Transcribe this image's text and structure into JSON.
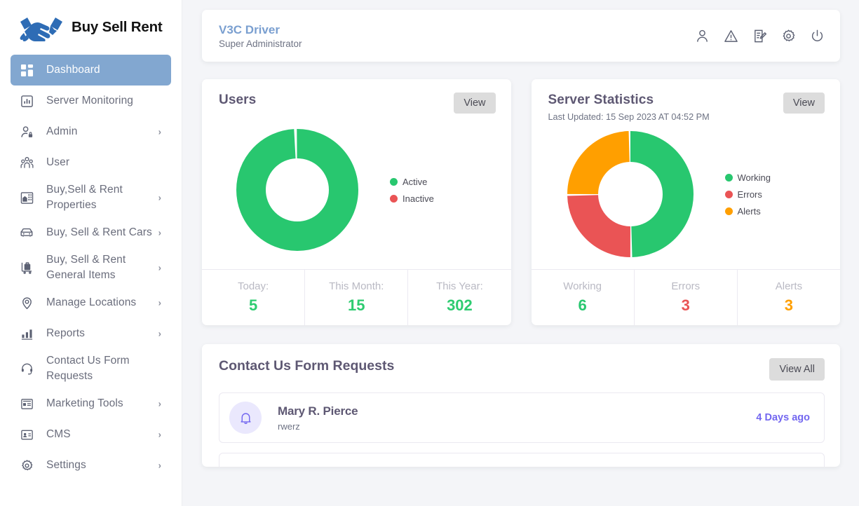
{
  "brand": {
    "name": "Buy Sell Rent",
    "logo_icon": "handshake-icon",
    "logo_color": "#2e6cb5"
  },
  "sidebar": {
    "items": [
      {
        "label": "Dashboard",
        "icon": "grid-dashboard-icon",
        "active": true,
        "chevron": ""
      },
      {
        "label": "Server Monitoring",
        "icon": "chart-bar-box-icon",
        "active": false,
        "chevron": ""
      },
      {
        "label": "Admin",
        "icon": "user-lock-icon",
        "active": false,
        "chevron": "›"
      },
      {
        "label": "User",
        "icon": "users-group-icon",
        "active": false,
        "chevron": ""
      },
      {
        "label": "Buy,Sell & Rent Properties",
        "icon": "building-icon",
        "active": false,
        "chevron": "›"
      },
      {
        "label": "Buy, Sell & Rent Cars",
        "icon": "car-icon",
        "active": false,
        "chevron": "›"
      },
      {
        "label": "Buy, Sell & Rent General Items",
        "icon": "shopping-trolley-icon",
        "active": false,
        "chevron": "›"
      },
      {
        "label": "Manage Locations",
        "icon": "map-pin-icon",
        "active": false,
        "chevron": "›"
      },
      {
        "label": "Reports",
        "icon": "bar-chart-icon",
        "active": false,
        "chevron": "›"
      },
      {
        "label": "Contact Us Form Requests",
        "icon": "headset-icon",
        "active": false,
        "chevron": ""
      },
      {
        "label": "Marketing Tools",
        "icon": "article-card-icon",
        "active": false,
        "chevron": "›"
      },
      {
        "label": "CMS",
        "icon": "id-card-icon",
        "active": false,
        "chevron": "›"
      },
      {
        "label": "Settings",
        "icon": "gear-icon",
        "active": false,
        "chevron": "›"
      }
    ]
  },
  "topbar": {
    "user_name": "V3C Driver",
    "user_role": "Super Administrator",
    "icons": [
      {
        "name": "profile-icon"
      },
      {
        "name": "warning-triangle-icon"
      },
      {
        "name": "edit-document-icon"
      },
      {
        "name": "gear-icon"
      },
      {
        "name": "power-icon"
      }
    ]
  },
  "users_card": {
    "title": "Users",
    "view_label": "View",
    "footer": [
      {
        "label": "Today:",
        "value": "5",
        "color": "#2ecc71"
      },
      {
        "label": "This Month:",
        "value": "15",
        "color": "#2ecc71"
      },
      {
        "label": "This Year:",
        "value": "302",
        "color": "#2ecc71"
      }
    ]
  },
  "server_card": {
    "title": "Server Statistics",
    "subtitle": "Last Updated: 15 Sep 2023 AT 04:52 PM",
    "view_label": "View",
    "footer": [
      {
        "label": "Working",
        "value": "6",
        "color": "#28c76f"
      },
      {
        "label": "Errors",
        "value": "3",
        "color": "#ea5455"
      },
      {
        "label": "Alerts",
        "value": "3",
        "color": "#ff9f00"
      }
    ]
  },
  "contact_section": {
    "title": "Contact Us Form Requests",
    "view_all_label": "View All",
    "rows": [
      {
        "name": "Mary R. Pierce",
        "message": "rwerz",
        "time": "4 Days ago",
        "icon": "bell-icon"
      }
    ]
  },
  "chart_data": [
    {
      "type": "pie",
      "title": "Users",
      "variant": "donut",
      "labels": [
        "Active",
        "Inactive"
      ],
      "values": [
        100,
        0
      ],
      "colors": [
        "#28c76f",
        "#ea5455"
      ],
      "legend_position": "right"
    },
    {
      "type": "pie",
      "title": "Server Statistics",
      "variant": "donut",
      "labels": [
        "Working",
        "Errors",
        "Alerts"
      ],
      "values": [
        6,
        3,
        3
      ],
      "colors": [
        "#28c76f",
        "#ea5455",
        "#ff9f00"
      ],
      "legend_position": "right"
    }
  ]
}
